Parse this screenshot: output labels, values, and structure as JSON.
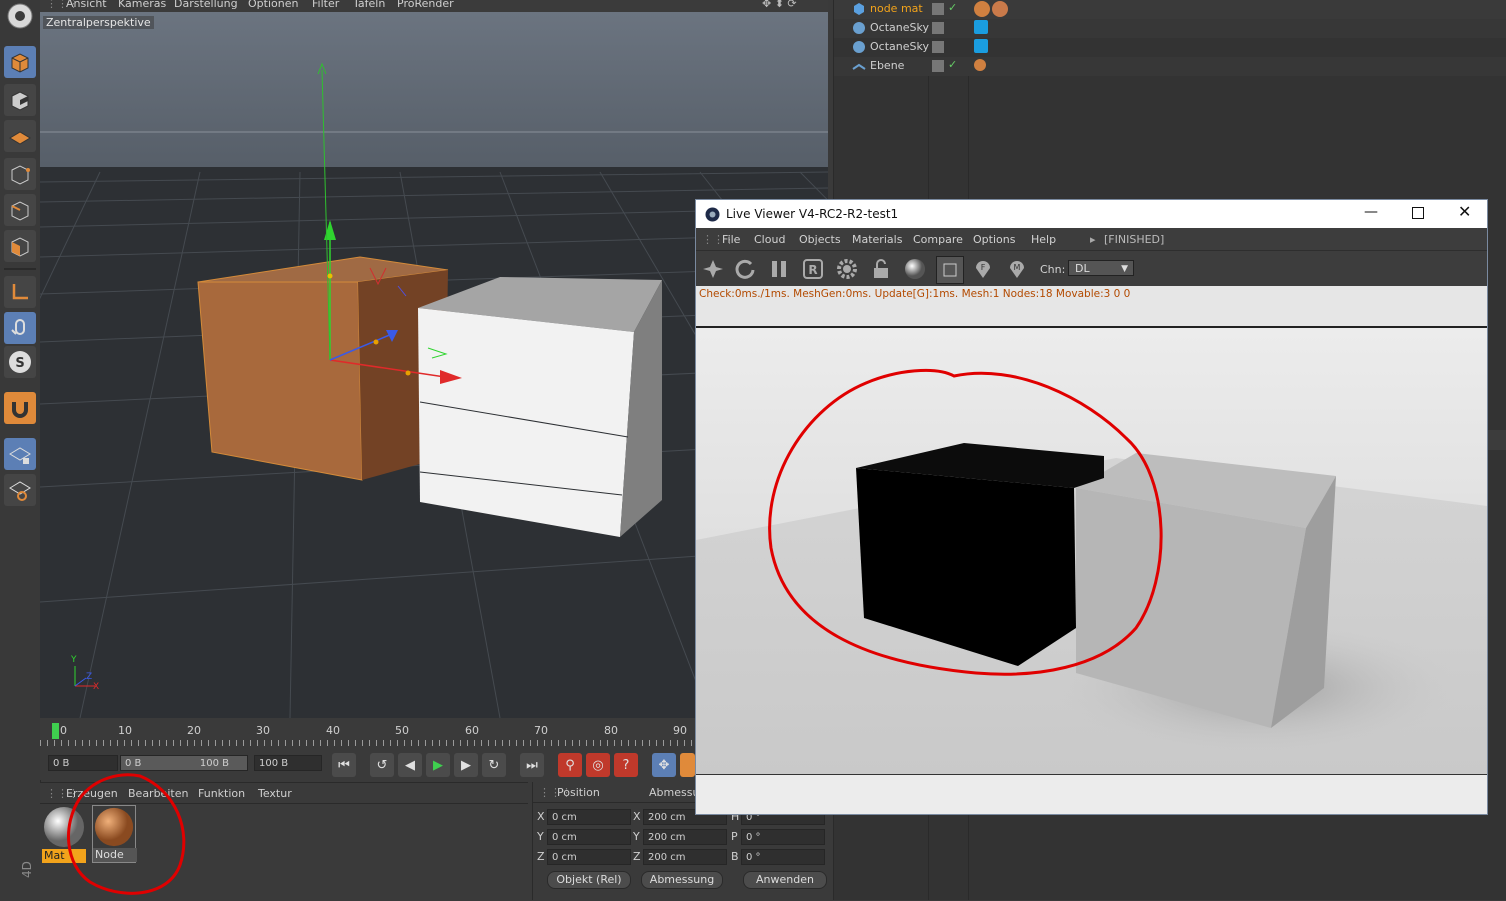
{
  "viewport": {
    "menu": [
      "Ansicht",
      "Kameras",
      "Darstellung",
      "Optionen",
      "Filter",
      "Tafeln",
      "ProRender"
    ],
    "view_name": "Zentralperspektive",
    "axis_labels": {
      "y": "Y",
      "z": "Z",
      "x": "X"
    }
  },
  "timeline": {
    "ticks": [
      "0",
      "10",
      "20",
      "30",
      "40",
      "50",
      "60",
      "70",
      "80",
      "90"
    ],
    "current_frame": "0 B",
    "range_start": "0 B",
    "range_end": "100 B",
    "end_frame": "100 B"
  },
  "material_manager": {
    "menu": [
      "Erzeugen",
      "Bearbeiten",
      "Funktion",
      "Textur"
    ],
    "materials": [
      {
        "name": "Mat"
      },
      {
        "name": "Node"
      }
    ]
  },
  "coordinates": {
    "headers": {
      "position": "Position",
      "size": "Abmessung"
    },
    "rows": [
      {
        "axis": "X",
        "pos": "0 cm",
        "size_axis": "X",
        "size": "200 cm",
        "rot_axis": "H",
        "rot": "0 °"
      },
      {
        "axis": "Y",
        "pos": "0 cm",
        "size_axis": "Y",
        "size": "200 cm",
        "rot_axis": "P",
        "rot": "0 °"
      },
      {
        "axis": "Z",
        "pos": "0 cm",
        "size_axis": "Z",
        "size": "200 cm",
        "rot_axis": "B",
        "rot": "0 °"
      }
    ],
    "mode_dropdown": "Objekt (Rel)",
    "size_dropdown": "Abmessung",
    "apply_button": "Anwenden"
  },
  "object_manager": {
    "objects": [
      {
        "name": "node mat",
        "selected": true
      },
      {
        "name": "OctaneSky"
      },
      {
        "name": "OctaneSky"
      },
      {
        "name": "Ebene"
      }
    ]
  },
  "live_viewer": {
    "title": "Live Viewer V4-RC2-R2-test1",
    "menu": [
      "File",
      "Cloud",
      "Objects",
      "Materials",
      "Compare",
      "Options",
      "Help"
    ],
    "status_tag": "[FINISHED]",
    "channel_label": "Chn:",
    "channel_value": "DL",
    "status_line": "Check:0ms./1ms. MeshGen:0ms. Update[G]:1ms. Mesh:1 Nodes:18 Movable:3  0 0"
  },
  "side_label": "4D",
  "colors": {
    "accent_selected": "#f2a31b",
    "annotation_red": "#e00000",
    "orange_cube": "#a9693d",
    "status_text": "#b34a00"
  }
}
